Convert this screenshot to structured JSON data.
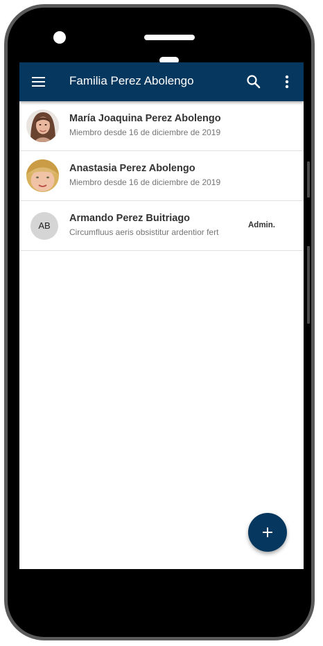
{
  "app_bar": {
    "title": "Familia Perez Abolengo",
    "menu_icon": "menu-icon",
    "search_icon": "search-icon",
    "more_icon": "more-vert-icon",
    "background": "#06385f"
  },
  "members": [
    {
      "name": "María Joaquina Perez Abolengo",
      "subtitle": "Miembro desde 16 de diciembre de 2019",
      "avatar": "photo",
      "role": ""
    },
    {
      "name": "Anastasia Perez Abolengo",
      "subtitle": "Miembro desde 16 de diciembre de 2019",
      "avatar": "photo",
      "role": ""
    },
    {
      "name": "Armando Perez Buitriago",
      "subtitle": "Circumfluus aeris obsistitur ardentior fert",
      "initials": "AB",
      "role": "Admin."
    }
  ],
  "fab": {
    "icon": "plus-icon",
    "color": "#06385f"
  }
}
